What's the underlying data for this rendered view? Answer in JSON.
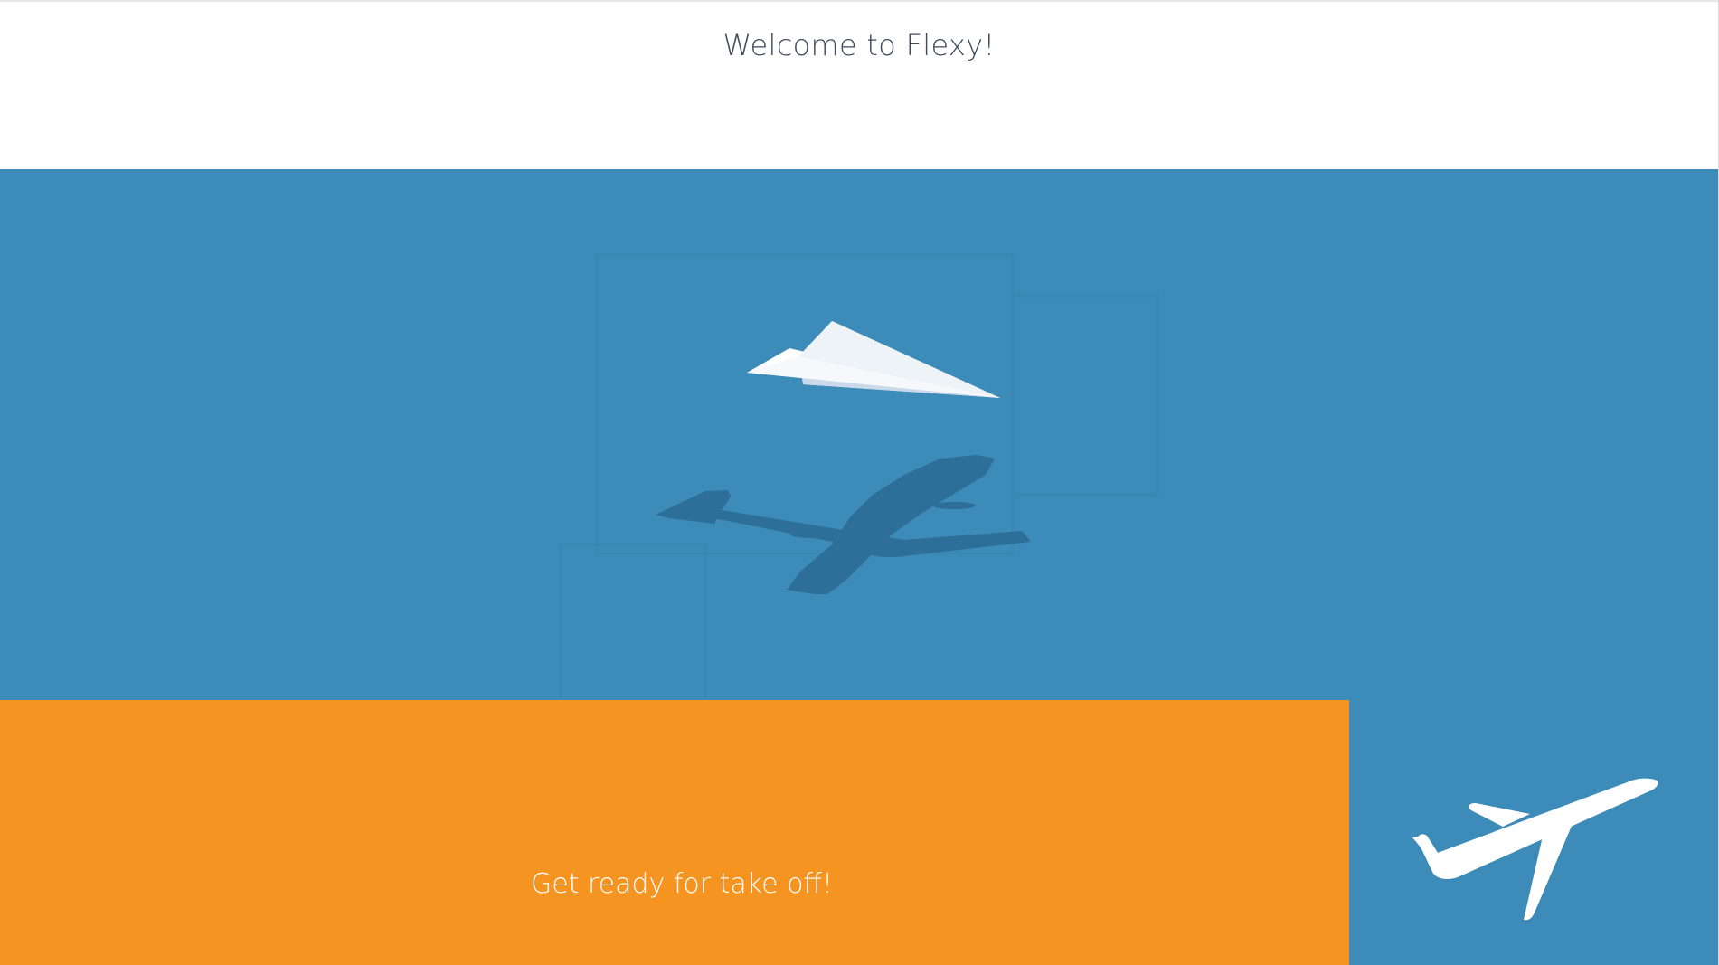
{
  "header": {
    "title": "Welcome to Flexy!"
  },
  "hero": {
    "illustration": "paper-plane-with-airplane-shadow",
    "background_color": "#3d8bb8"
  },
  "cta": {
    "text": "Get ready for take off!",
    "background_color": "#f59421"
  },
  "side_panel": {
    "icon": "airplane-takeoff-icon",
    "background_color": "#3d8bb8"
  }
}
